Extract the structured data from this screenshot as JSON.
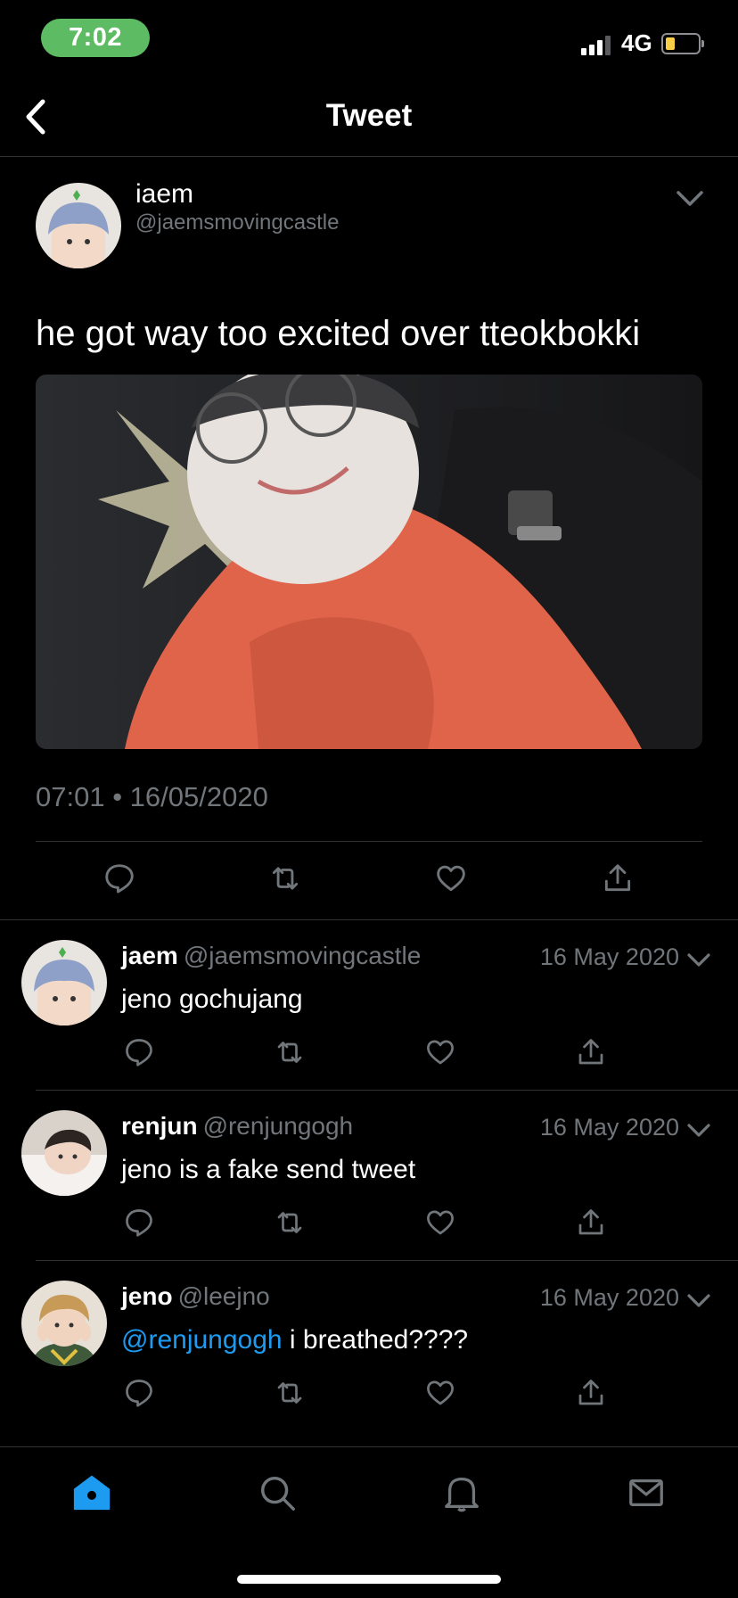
{
  "status_bar": {
    "time": "7:02",
    "network": "4G",
    "battery_level": 0.3
  },
  "nav": {
    "title": "Tweet",
    "back_icon": "chevron-left-icon"
  },
  "main_tweet": {
    "author_name": "iaem",
    "author_handle": "@jaemsmovingcastle",
    "text": "he got way too excited over tteokbokki",
    "timestamp": "07:01 • 16/05/2020",
    "actions": [
      "reply-icon",
      "retweet-icon",
      "like-icon",
      "share-icon"
    ]
  },
  "replies": [
    {
      "name": "jaem",
      "handle": "@jaemsmovingcastle",
      "date": "16 May 2020",
      "mention": "",
      "text": "jeno gochujang"
    },
    {
      "name": "renjun",
      "handle": "@renjungogh",
      "date": "16 May 2020",
      "mention": "",
      "text": "jeno is a fake send tweet"
    },
    {
      "name": "jeno",
      "handle": "@leejno",
      "date": "16 May 2020",
      "mention": "@renjungogh",
      "text": " i breathed????"
    }
  ],
  "tabbar": {
    "items": [
      "home-icon",
      "search-icon",
      "bell-icon",
      "mail-icon"
    ],
    "active": "home-icon"
  },
  "colors": {
    "background": "#000000",
    "accent": "#1d9bf0",
    "muted": "#71767b",
    "divider": "#2f3336",
    "status_pill": "#5dbb63"
  }
}
